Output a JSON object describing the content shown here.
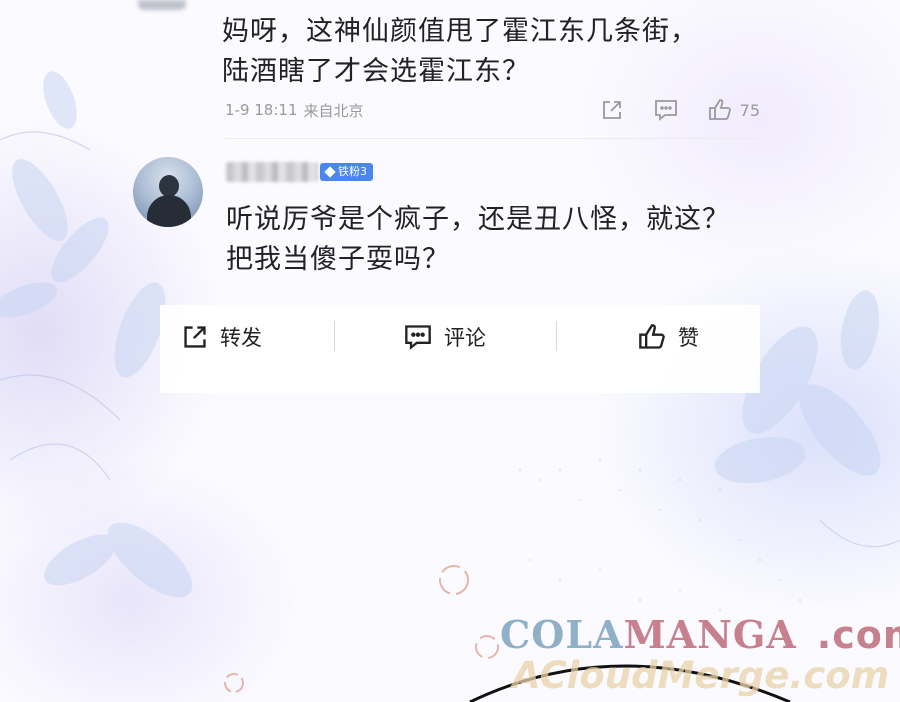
{
  "comment1": {
    "text_line1": "妈呀，这神仙颜值甩了霍江东几条街，",
    "text_line2": "陆酒瞎了才会选霍江东？",
    "time": "1-9 18:11",
    "location": "来自北京",
    "like_count": "75"
  },
  "comment2": {
    "badge": "铁粉3",
    "text_line1": "听说厉爷是个疯子，还是丑八怪，就这？",
    "text_line2": "把我当傻子耍吗？"
  },
  "actions": {
    "forward_label": "转发",
    "comment_label": "评论",
    "like_label": "赞"
  },
  "watermark": {
    "cola": "COLA",
    "manga": "MANGA",
    "com": ".com",
    "line2": "ACloudMerge.com"
  },
  "colors": {
    "badge": "#4a86ec",
    "text": "#222222",
    "meta": "#9a9a9a"
  }
}
